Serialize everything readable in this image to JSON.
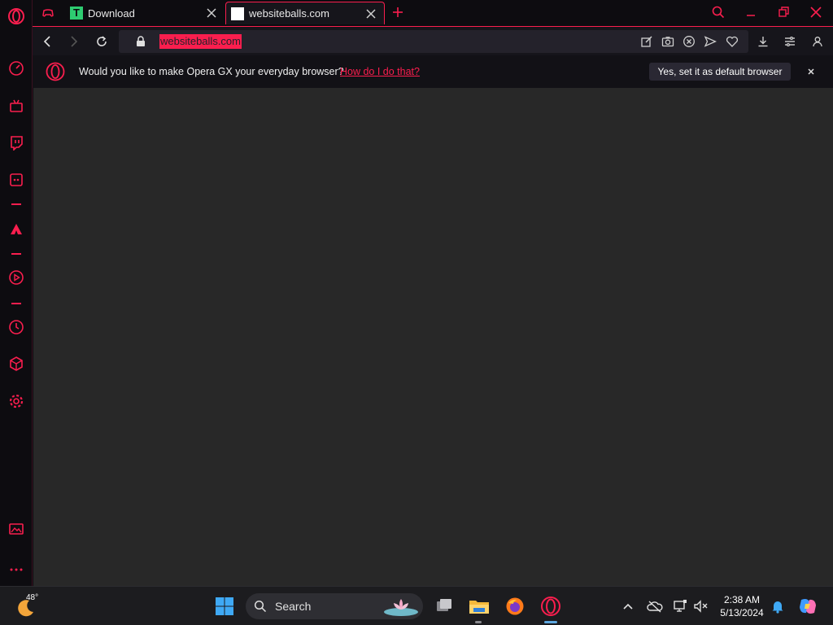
{
  "colors": {
    "accent": "#fa1e4e",
    "background": "#0d0c10",
    "content": "#282828"
  },
  "tabs": [
    {
      "title": "Download",
      "favicon": "t-favicon-icon",
      "active": false
    },
    {
      "title": "websiteballs.com",
      "favicon": "blank-page-icon",
      "active": true
    }
  ],
  "address_bar": {
    "url": "websiteballs.com"
  },
  "notification": {
    "message": "Would you like to make Opera GX your everyday browser?",
    "link": "How do I do that?",
    "button": "Yes, set it as default browser"
  },
  "taskbar": {
    "weather_temp": "48°",
    "search_label": "Search",
    "time": "2:38 AM",
    "date": "5/13/2024"
  }
}
